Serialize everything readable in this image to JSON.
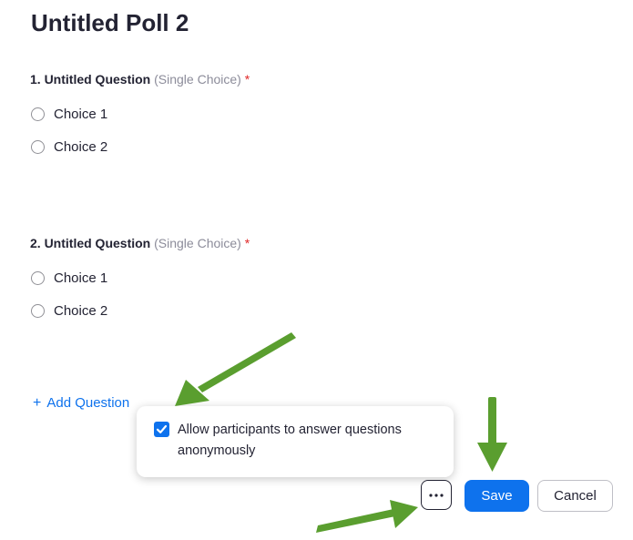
{
  "poll": {
    "title": "Untitled Poll 2"
  },
  "questions": [
    {
      "title": "1. Untitled Question",
      "type": "(Single Choice)",
      "required_mark": "*",
      "choices": [
        "Choice 1",
        "Choice 2"
      ]
    },
    {
      "title": "2. Untitled Question",
      "type": "(Single Choice)",
      "required_mark": "*",
      "choices": [
        "Choice 1",
        "Choice 2"
      ]
    }
  ],
  "add_question": {
    "icon": "+",
    "label": "Add Question"
  },
  "popup": {
    "checkbox_checked": true,
    "label": "Allow participants to answer questions anonymously"
  },
  "footer": {
    "more_icon": "ellipsis-icon",
    "save_label": "Save",
    "cancel_label": "Cancel"
  },
  "colors": {
    "accent": "#0e72ed",
    "annotation_arrow": "#5a9e2f",
    "required": "#e02828"
  }
}
